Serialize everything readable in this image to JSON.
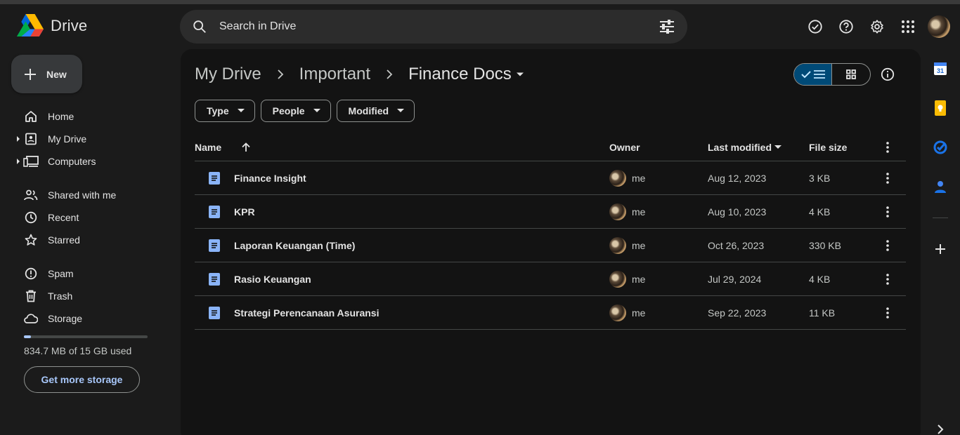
{
  "app": {
    "title": "Drive"
  },
  "search": {
    "placeholder": "Search in Drive"
  },
  "sidebar": {
    "new_label": "New",
    "items": [
      {
        "label": "Home",
        "icon": "home-icon"
      },
      {
        "label": "My Drive",
        "icon": "my-drive-icon"
      },
      {
        "label": "Computers",
        "icon": "computers-icon"
      },
      {
        "label": "Shared with me",
        "icon": "people-icon"
      },
      {
        "label": "Recent",
        "icon": "clock-icon"
      },
      {
        "label": "Starred",
        "icon": "star-icon"
      },
      {
        "label": "Spam",
        "icon": "spam-icon"
      },
      {
        "label": "Trash",
        "icon": "trash-icon"
      },
      {
        "label": "Storage",
        "icon": "cloud-icon"
      }
    ],
    "storage_used_fraction": 0.054,
    "storage_text": "834.7 MB of 15 GB used",
    "get_storage_label": "Get more storage"
  },
  "breadcrumb": {
    "items": [
      "My Drive",
      "Important"
    ],
    "current": "Finance Docs"
  },
  "filters": [
    "Type",
    "People",
    "Modified"
  ],
  "table": {
    "columns": {
      "name": "Name",
      "owner": "Owner",
      "modified": "Last modified",
      "size": "File size"
    },
    "rows": [
      {
        "name": "Finance Insight",
        "owner": "me",
        "modified": "Aug 12, 2023",
        "size": "3 KB"
      },
      {
        "name": "KPR",
        "owner": "me",
        "modified": "Aug 10, 2023",
        "size": "4 KB"
      },
      {
        "name": "Laporan Keuangan (Time)",
        "owner": "me",
        "modified": "Oct 26, 2023",
        "size": "330 KB"
      },
      {
        "name": "Rasio Keuangan",
        "owner": "me",
        "modified": "Jul 29, 2024",
        "size": "4 KB"
      },
      {
        "name": "Strategi Perencanaan Asuransi",
        "owner": "me",
        "modified": "Sep 22, 2023",
        "size": "11 KB"
      }
    ]
  },
  "colors": {
    "accent": "#a8c7fa",
    "doc_icon": "#8ab4f8",
    "selected_view": "#004a77"
  }
}
